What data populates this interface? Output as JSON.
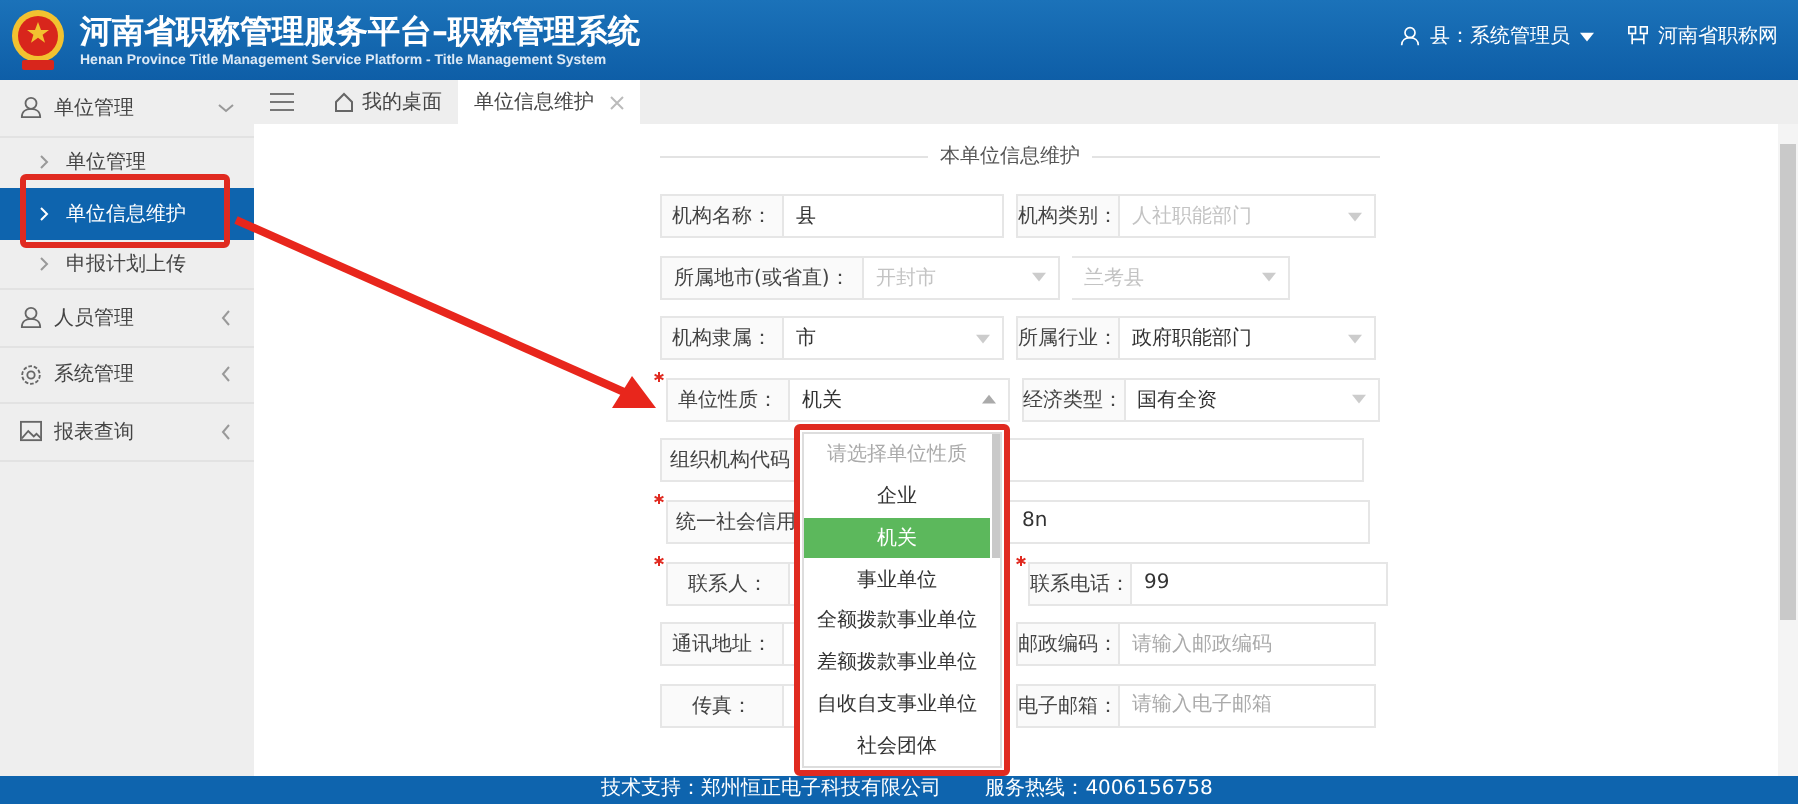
{
  "header": {
    "title": "河南省职称管理服务平台–职称管理系统",
    "subtitle": "Henan Province Title Management Service Platform - Title Management System",
    "user": "县：系统管理员",
    "link": "河南省职称网"
  },
  "sidebar": {
    "items": [
      {
        "label": "单位管理",
        "expanded": true,
        "children": [
          {
            "label": "单位管理",
            "selected": false
          },
          {
            "label": "单位信息维护",
            "selected": true
          },
          {
            "label": "申报计划上传",
            "selected": false
          }
        ]
      },
      {
        "label": "人员管理",
        "expanded": false
      },
      {
        "label": "系统管理",
        "expanded": false
      },
      {
        "label": "报表查询",
        "expanded": false
      }
    ]
  },
  "tabs": [
    {
      "label": "我的桌面",
      "kind": "home",
      "closable": false,
      "selected": false
    },
    {
      "label": "单位信息维护",
      "closable": true,
      "selected": true
    }
  ],
  "form": {
    "legend": "本单位信息维护",
    "rows": [
      {
        "fields": [
          {
            "label": "机构名称：",
            "kind": "text",
            "value": "县"
          },
          {
            "label": "机构类别：",
            "kind": "select",
            "value": "人社职能部门",
            "disabled": true
          }
        ]
      },
      {
        "fields": [
          {
            "label": "所属地市(或省直)：",
            "kind": "select",
            "value": "开封市",
            "disabled": true
          },
          {
            "kind": "select",
            "value": "兰考县",
            "disabled": true
          }
        ]
      },
      {
        "fields": [
          {
            "label": "机构隶属：",
            "kind": "select",
            "value": "市"
          },
          {
            "label": "所属行业：",
            "kind": "select",
            "value": "政府职能部门"
          }
        ]
      },
      {
        "fields": [
          {
            "label": "单位性质：",
            "kind": "select",
            "value": "机关",
            "required": true,
            "open": true
          },
          {
            "label": "经济类型：",
            "kind": "select",
            "value": "国有全资"
          }
        ]
      },
      {
        "fields": [
          {
            "label": "组织机构代码",
            "kind": "text"
          }
        ]
      },
      {
        "fields": [
          {
            "label": "统一社会信用",
            "kind": "text",
            "value": "8n",
            "required": true
          }
        ]
      },
      {
        "fields": [
          {
            "label": "联系人：",
            "kind": "text",
            "required": true
          },
          {
            "label": "联系电话：",
            "kind": "text",
            "value": "99",
            "required": true
          }
        ]
      },
      {
        "fields": [
          {
            "label": "通讯地址：",
            "kind": "text"
          },
          {
            "label": "邮政编码：",
            "kind": "text",
            "placeholder": "请输入邮政编码"
          }
        ]
      },
      {
        "fields": [
          {
            "label": "传真：",
            "kind": "text"
          },
          {
            "label": "电子邮箱：",
            "kind": "text",
            "placeholder": "请输入电子邮箱"
          }
        ]
      }
    ]
  },
  "dropdown": {
    "options": [
      {
        "label": "请选择单位性质",
        "kind": "placeholder",
        "selected": false
      },
      {
        "label": "企业",
        "kind": "option",
        "selected": false
      },
      {
        "label": "机关",
        "kind": "option",
        "selected": true
      },
      {
        "label": "事业单位",
        "kind": "option",
        "selected": false
      },
      {
        "label": "全额拨款事业单位",
        "kind": "option",
        "selected": false
      },
      {
        "label": "差额拨款事业单位",
        "kind": "option",
        "selected": false
      },
      {
        "label": "自收自支事业单位",
        "kind": "option",
        "selected": false
      },
      {
        "label": "社会团体",
        "kind": "option",
        "selected": false
      }
    ]
  },
  "footer": {
    "support": "技术支持：郑州恒正电子科技有限公司",
    "hotline": "服务热线：4006156758"
  }
}
